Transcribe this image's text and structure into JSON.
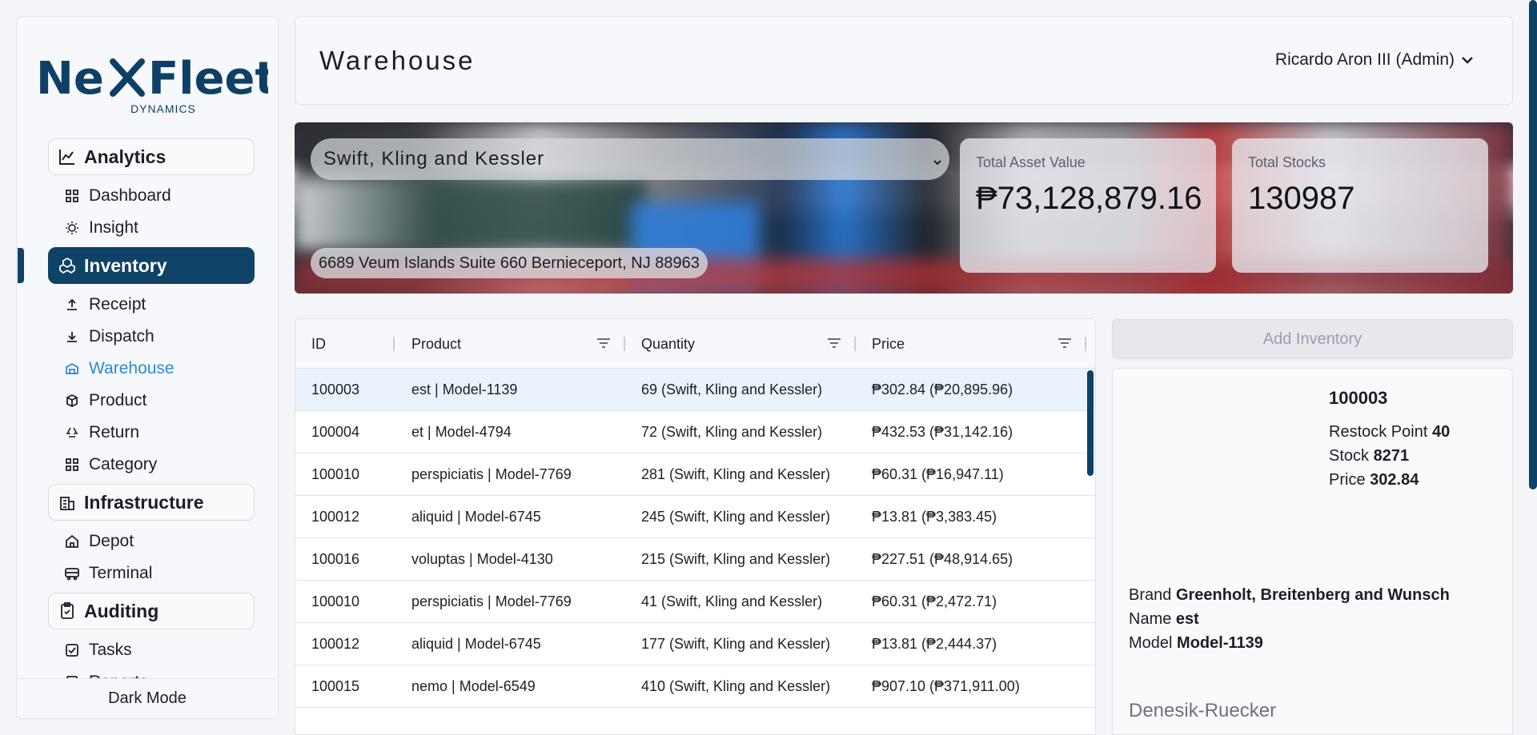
{
  "logo": {
    "word_left": "Ne",
    "word_right": "Fleet",
    "sub": "DYNAMICS"
  },
  "sidebar": {
    "groups": [
      {
        "label": "Analytics",
        "icon": "chart-icon",
        "items": [
          {
            "label": "Dashboard",
            "icon": "grid-icon"
          },
          {
            "label": "Insight",
            "icon": "bulb-icon"
          }
        ]
      },
      {
        "label": "Inventory",
        "icon": "boxes-icon",
        "active": true,
        "items": [
          {
            "label": "Receipt",
            "icon": "upload-icon"
          },
          {
            "label": "Dispatch",
            "icon": "download-icon"
          },
          {
            "label": "Warehouse",
            "icon": "warehouse-icon",
            "current": true
          },
          {
            "label": "Product",
            "icon": "package-icon"
          },
          {
            "label": "Return",
            "icon": "recycle-icon"
          },
          {
            "label": "Category",
            "icon": "grid-icon"
          }
        ]
      },
      {
        "label": "Infrastructure",
        "icon": "building-icon",
        "items": [
          {
            "label": "Depot",
            "icon": "home-icon"
          },
          {
            "label": "Terminal",
            "icon": "bus-icon"
          }
        ]
      },
      {
        "label": "Auditing",
        "icon": "clipboard-icon",
        "items": [
          {
            "label": "Tasks",
            "icon": "checkbox-icon"
          },
          {
            "label": "Reports",
            "icon": "report-icon"
          }
        ]
      }
    ],
    "footer": "Dark Mode"
  },
  "header": {
    "title": "Warehouse",
    "user": "Ricardo Aron III (Admin)"
  },
  "banner": {
    "company": "Swift, Kling and Kessler",
    "address": "6689 Veum Islands Suite 660 Bernieceport, NJ 88963",
    "total_asset_label": "Total Asset Value",
    "total_asset_value": "₱73,128,879.16",
    "total_stocks_label": "Total Stocks",
    "total_stocks_value": "130987"
  },
  "table": {
    "columns": [
      "ID",
      "Product",
      "Quantity",
      "Price"
    ],
    "rows": [
      {
        "id": "100003",
        "product": "est | Model-1139",
        "quantity": "69 (Swift, Kling and Kessler)",
        "price": "₱302.84 (₱20,895.96)"
      },
      {
        "id": "100004",
        "product": "et | Model-4794",
        "quantity": "72 (Swift, Kling and Kessler)",
        "price": "₱432.53 (₱31,142.16)"
      },
      {
        "id": "100010",
        "product": "perspiciatis | Model-7769",
        "quantity": "281 (Swift, Kling and Kessler)",
        "price": "₱60.31 (₱16,947.11)"
      },
      {
        "id": "100012",
        "product": "aliquid | Model-6745",
        "quantity": "245 (Swift, Kling and Kessler)",
        "price": "₱13.81 (₱3,383.45)"
      },
      {
        "id": "100016",
        "product": "voluptas | Model-4130",
        "quantity": "215 (Swift, Kling and Kessler)",
        "price": "₱227.51 (₱48,914.65)"
      },
      {
        "id": "100010",
        "product": "perspiciatis | Model-7769",
        "quantity": "41 (Swift, Kling and Kessler)",
        "price": "₱60.31 (₱2,472.71)"
      },
      {
        "id": "100012",
        "product": "aliquid | Model-6745",
        "quantity": "177 (Swift, Kling and Kessler)",
        "price": "₱13.81 (₱2,444.37)"
      },
      {
        "id": "100015",
        "product": "nemo | Model-6549",
        "quantity": "410 (Swift, Kling and Kessler)",
        "price": "₱907.10 (₱371,911.00)"
      }
    ]
  },
  "detail": {
    "add_button": "Add Inventory",
    "id": "100003",
    "restock_label": "Restock Point",
    "restock_value": "40",
    "stock_label": "Stock",
    "stock_value": "8271",
    "price_label": "Price",
    "price_value": "302.84",
    "brand_label": "Brand",
    "brand_value": "Greenholt, Breitenberg and Wunsch",
    "name_label": "Name",
    "name_value": "est",
    "model_label": "Model",
    "model_value": "Model-1139",
    "brand_sub": "Denesik-Ruecker"
  },
  "colors": {
    "primary": "#0e4266",
    "accent": "#2a8ad8"
  }
}
